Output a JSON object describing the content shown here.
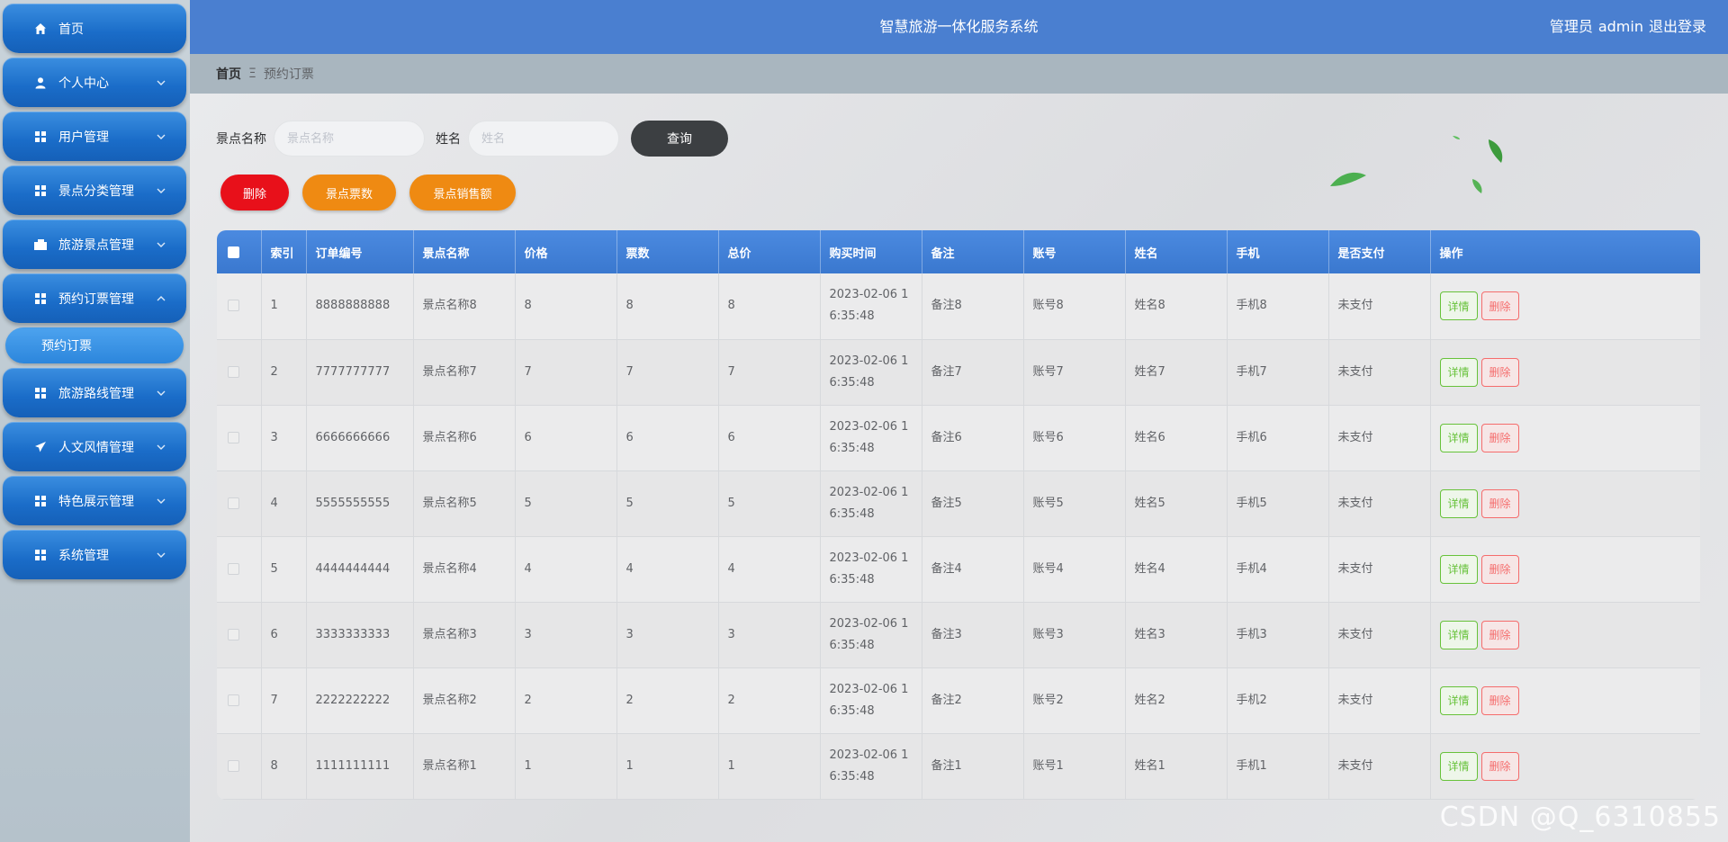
{
  "header": {
    "title": "智慧旅游一体化服务系统",
    "user_role": "管理员",
    "username": "admin",
    "logout": "退出登录"
  },
  "sidebar": {
    "items": [
      {
        "label": "首页",
        "icon": "home-icon"
      },
      {
        "label": "个人中心",
        "icon": "user-icon"
      },
      {
        "label": "用户管理",
        "icon": "grid-icon"
      },
      {
        "label": "景点分类管理",
        "icon": "grid-icon"
      },
      {
        "label": "旅游景点管理",
        "icon": "id-card-icon"
      },
      {
        "label": "预约订票管理",
        "icon": "grid-icon"
      },
      {
        "label": "旅游路线管理",
        "icon": "grid-icon"
      },
      {
        "label": "人文风情管理",
        "icon": "paper-plane-icon"
      },
      {
        "label": "特色展示管理",
        "icon": "grid-icon"
      },
      {
        "label": "系统管理",
        "icon": "grid-icon"
      }
    ],
    "submenu": {
      "label": "预约订票"
    }
  },
  "breadcrumb": {
    "home": "首页",
    "sep": "Ξ",
    "current": "预约订票"
  },
  "search": {
    "label1": "景点名称",
    "placeholder1": "景点名称",
    "label2": "姓名",
    "placeholder2": "姓名",
    "query_button": "查询"
  },
  "actions": {
    "delete": "删除",
    "ticket_count": "景点票数",
    "sales": "景点销售额"
  },
  "table": {
    "headers": [
      "索引",
      "订单编号",
      "景点名称",
      "价格",
      "票数",
      "总价",
      "购买时间",
      "备注",
      "账号",
      "姓名",
      "手机",
      "是否支付",
      "操作"
    ],
    "detail_label": "详情",
    "delete_label": "删除",
    "rows": [
      {
        "idx": "1",
        "order": "8888888888",
        "name": "景点名称8",
        "price": "8",
        "count": "8",
        "total": "8",
        "time1": "2023-02-06 1",
        "time2": "6:35:48",
        "note": "备注8",
        "account": "账号8",
        "person": "姓名8",
        "phone": "手机8",
        "paid": "未支付"
      },
      {
        "idx": "2",
        "order": "7777777777",
        "name": "景点名称7",
        "price": "7",
        "count": "7",
        "total": "7",
        "time1": "2023-02-06 1",
        "time2": "6:35:48",
        "note": "备注7",
        "account": "账号7",
        "person": "姓名7",
        "phone": "手机7",
        "paid": "未支付"
      },
      {
        "idx": "3",
        "order": "6666666666",
        "name": "景点名称6",
        "price": "6",
        "count": "6",
        "total": "6",
        "time1": "2023-02-06 1",
        "time2": "6:35:48",
        "note": "备注6",
        "account": "账号6",
        "person": "姓名6",
        "phone": "手机6",
        "paid": "未支付"
      },
      {
        "idx": "4",
        "order": "5555555555",
        "name": "景点名称5",
        "price": "5",
        "count": "5",
        "total": "5",
        "time1": "2023-02-06 1",
        "time2": "6:35:48",
        "note": "备注5",
        "account": "账号5",
        "person": "姓名5",
        "phone": "手机5",
        "paid": "未支付"
      },
      {
        "idx": "5",
        "order": "4444444444",
        "name": "景点名称4",
        "price": "4",
        "count": "4",
        "total": "4",
        "time1": "2023-02-06 1",
        "time2": "6:35:48",
        "note": "备注4",
        "account": "账号4",
        "person": "姓名4",
        "phone": "手机4",
        "paid": "未支付"
      },
      {
        "idx": "6",
        "order": "3333333333",
        "name": "景点名称3",
        "price": "3",
        "count": "3",
        "total": "3",
        "time1": "2023-02-06 1",
        "time2": "6:35:48",
        "note": "备注3",
        "account": "账号3",
        "person": "姓名3",
        "phone": "手机3",
        "paid": "未支付"
      },
      {
        "idx": "7",
        "order": "2222222222",
        "name": "景点名称2",
        "price": "2",
        "count": "2",
        "total": "2",
        "time1": "2023-02-06 1",
        "time2": "6:35:48",
        "note": "备注2",
        "account": "账号2",
        "person": "姓名2",
        "phone": "手机2",
        "paid": "未支付"
      },
      {
        "idx": "8",
        "order": "1111111111",
        "name": "景点名称1",
        "price": "1",
        "count": "1",
        "total": "1",
        "time1": "2023-02-06 1",
        "time2": "6:35:48",
        "note": "备注1",
        "account": "账号1",
        "person": "姓名1",
        "phone": "手机1",
        "paid": "未支付"
      }
    ]
  },
  "watermark": "CSDN @Q_6310855",
  "colors": {
    "header": "#4a7fd0",
    "menu": "#1a6cc8",
    "delete": "#e8101a",
    "orange": "#ef8a12",
    "query": "#3c3f42"
  }
}
